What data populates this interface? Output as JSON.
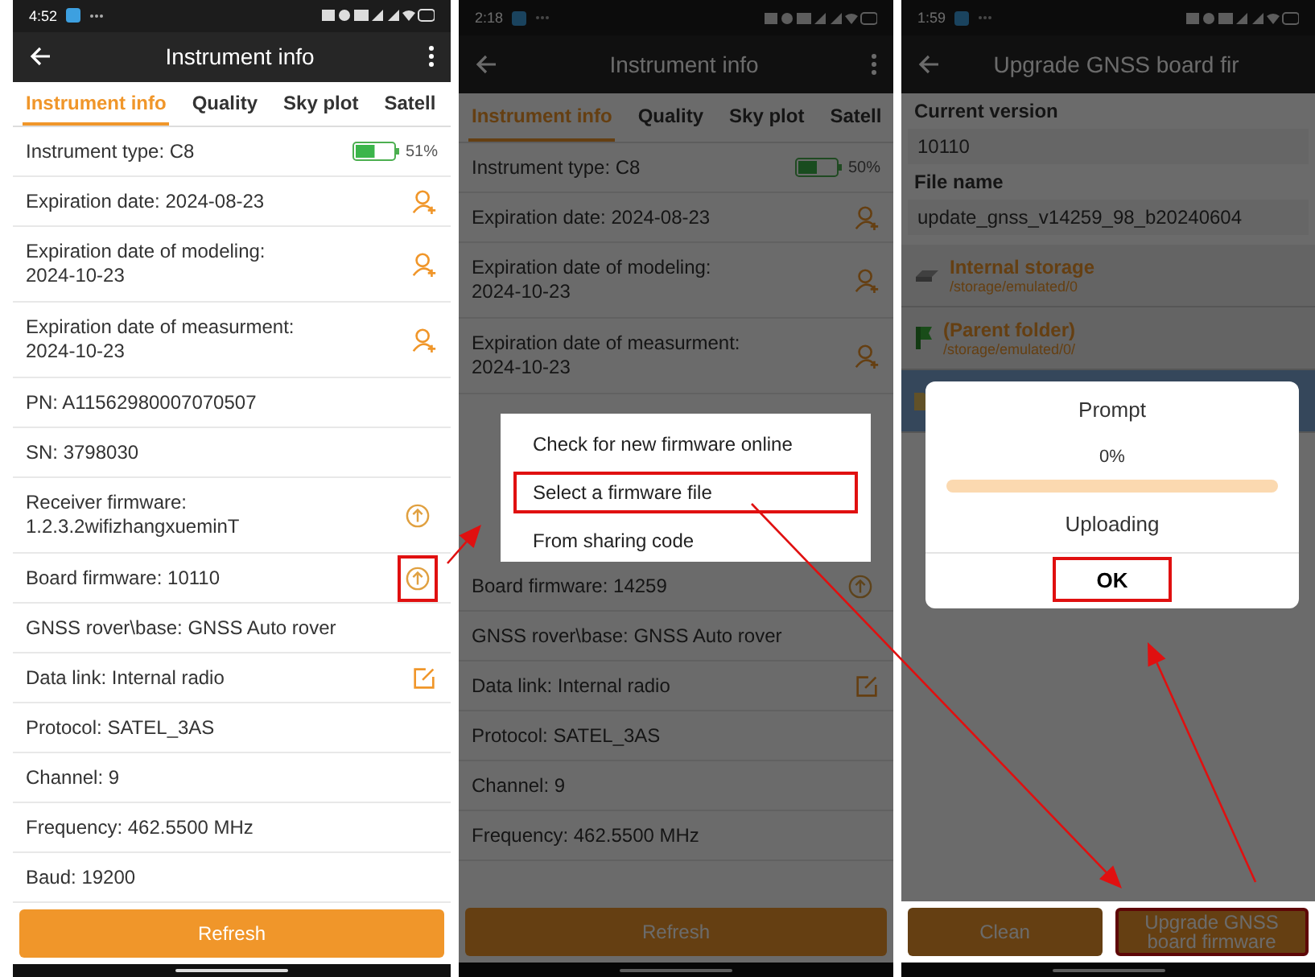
{
  "panels": [
    {
      "kind": "info",
      "dimmed": false,
      "time": "4:52",
      "title": "Instrument info",
      "overflow_menu": true,
      "tabs": [
        {
          "label": "Instrument info",
          "selected": true
        },
        {
          "label": "Quality",
          "selected": false
        },
        {
          "label": "Sky plot",
          "selected": false
        },
        {
          "label": "Satell",
          "selected": false
        }
      ],
      "rows": [
        {
          "kind": "battery",
          "text": "Instrument type: C8",
          "level": 0.51,
          "reading": "51%"
        },
        {
          "kind": "license",
          "text": "Expiration date: 2024-08-23"
        },
        {
          "kind": "license",
          "text": "Expiration date of modeling:\n2024-10-23"
        },
        {
          "kind": "license",
          "text": "Expiration date of measurment:\n2024-10-23"
        },
        {
          "kind": "plain",
          "text": "PN: A11562980007070507"
        },
        {
          "kind": "plain",
          "text": "SN: 3798030"
        },
        {
          "kind": "upgrade",
          "text": "Receiver firmware:\n1.2.3.2wifizhangxueminT",
          "highlighted": false
        },
        {
          "kind": "upgrade",
          "text": "Board firmware: 10110",
          "highlighted": true
        },
        {
          "kind": "plain",
          "text": "GNSS rover\\base: GNSS Auto rover"
        },
        {
          "kind": "edit",
          "text": "Data link: Internal radio"
        },
        {
          "kind": "plain",
          "text": "Protocol: SATEL_3AS"
        },
        {
          "kind": "plain",
          "text": "Channel: 9"
        },
        {
          "kind": "plain",
          "text": "Frequency: 462.5500 MHz"
        },
        {
          "kind": "plain",
          "text": "Baud: 19200"
        }
      ],
      "footer": [
        {
          "label": "Refresh",
          "highlighted": false
        }
      ]
    },
    {
      "kind": "info",
      "dimmed": true,
      "time": "2:18",
      "title": "Instrument info",
      "overflow_menu": true,
      "tabs": [
        {
          "label": "Instrument info",
          "selected": true
        },
        {
          "label": "Quality",
          "selected": false
        },
        {
          "label": "Sky plot",
          "selected": false
        },
        {
          "label": "Satell",
          "selected": false
        }
      ],
      "rows": [
        {
          "kind": "battery",
          "text": "Instrument type: C8",
          "level": 0.5,
          "reading": "50%"
        },
        {
          "kind": "license",
          "text": "Expiration date: 2024-08-23"
        },
        {
          "kind": "license",
          "text": "Expiration date of modeling:\n2024-10-23"
        },
        {
          "kind": "license",
          "text": "Expiration date of measurment:\n2024-10-23"
        },
        {
          "kind": "menu",
          "items": [
            {
              "label": "Check for new firmware online",
              "highlighted": false
            },
            {
              "label": "Select a firmware file",
              "highlighted": true
            },
            {
              "label": "From sharing code",
              "highlighted": false
            }
          ]
        },
        {
          "kind": "upgrade",
          "text": "Board firmware: 14259",
          "highlighted": false
        },
        {
          "kind": "plain",
          "text": "GNSS rover\\base: GNSS Auto rover"
        },
        {
          "kind": "edit",
          "text": "Data link: Internal radio"
        },
        {
          "kind": "plain",
          "text": "Protocol: SATEL_3AS"
        },
        {
          "kind": "plain",
          "text": "Channel: 9"
        },
        {
          "kind": "plain",
          "text": "Frequency: 462.5500 MHz"
        }
      ],
      "footer": [
        {
          "label": "Refresh",
          "highlighted": false
        }
      ]
    },
    {
      "kind": "upgrade",
      "dimmed": true,
      "time": "1:59",
      "title": "Upgrade GNSS board fir",
      "overflow_menu": false,
      "fields": [
        {
          "label": "Current version",
          "value": "10110"
        },
        {
          "label": "File name",
          "value": "update_gnss_v14259_98_b20240604"
        }
      ],
      "files": [
        {
          "kind": "storage",
          "name": "Internal storage",
          "path": "/storage/emulated/0",
          "selected": false
        },
        {
          "kind": "parent",
          "name": "(Parent folder)",
          "path": "/storage/emulated/0/",
          "selected": false
        },
        {
          "kind": "folder",
          "selected": true
        }
      ],
      "dialog": {
        "title": "Prompt",
        "percent": "0%",
        "status": "Uploading",
        "button": {
          "label": "OK",
          "highlighted": true
        }
      },
      "footer": [
        {
          "label": "Clean",
          "highlighted": false
        },
        {
          "label": "Upgrade GNSS board firmware",
          "highlighted": true
        }
      ]
    }
  ]
}
